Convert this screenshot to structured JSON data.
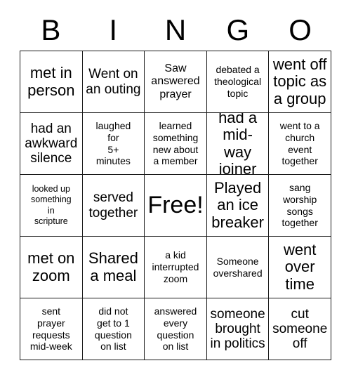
{
  "card": {
    "header_letters": [
      "B",
      "I",
      "N",
      "G",
      "O"
    ],
    "rows": [
      [
        {
          "text": "met in\nperson",
          "size": "xl"
        },
        {
          "text": "Went on\nan outing",
          "size": "lg"
        },
        {
          "text": "Saw\nanswered\nprayer",
          "size": "md"
        },
        {
          "text": "debated a\ntheological\ntopic",
          "size": "sm"
        },
        {
          "text": "went off\ntopic as\na group",
          "size": "xl"
        }
      ],
      [
        {
          "text": "had an\nawkward\nsilence",
          "size": "lg"
        },
        {
          "text": "laughed\nfor\n5+\nminutes",
          "size": "sm"
        },
        {
          "text": "learned\nsomething\nnew about\na member",
          "size": "sm"
        },
        {
          "text": "had a\nmid-way\njoiner",
          "size": "xl"
        },
        {
          "text": "went to a\nchurch\nevent\ntogether",
          "size": "sm"
        }
      ],
      [
        {
          "text": "looked up\nsomething\nin\nscripture",
          "size": "xs"
        },
        {
          "text": "served\ntogether",
          "size": "lg"
        },
        {
          "text": "Free!",
          "size": "xxl"
        },
        {
          "text": "Played\nan ice\nbreaker",
          "size": "xl"
        },
        {
          "text": "sang\nworship\nsongs\ntogether",
          "size": "sm"
        }
      ],
      [
        {
          "text": "met on\nzoom",
          "size": "xl"
        },
        {
          "text": "Shared\na meal",
          "size": "xl"
        },
        {
          "text": "a kid\ninterrupted\nzoom",
          "size": "sm"
        },
        {
          "text": "Someone\novershared",
          "size": "sm"
        },
        {
          "text": "went\nover\ntime",
          "size": "xl"
        }
      ],
      [
        {
          "text": "sent\nprayer\nrequests\nmid-week",
          "size": "sm"
        },
        {
          "text": "did not\nget to 1\nquestion\non list",
          "size": "sm"
        },
        {
          "text": "answered\nevery\nquestion\non list",
          "size": "sm"
        },
        {
          "text": "someone\nbrought\nin politics",
          "size": "lg"
        },
        {
          "text": "cut\nsomeone\noff",
          "size": "lg"
        }
      ]
    ]
  },
  "colors": {
    "border": "#1a1a1a",
    "background": "#ffffff",
    "text": "#000000"
  }
}
